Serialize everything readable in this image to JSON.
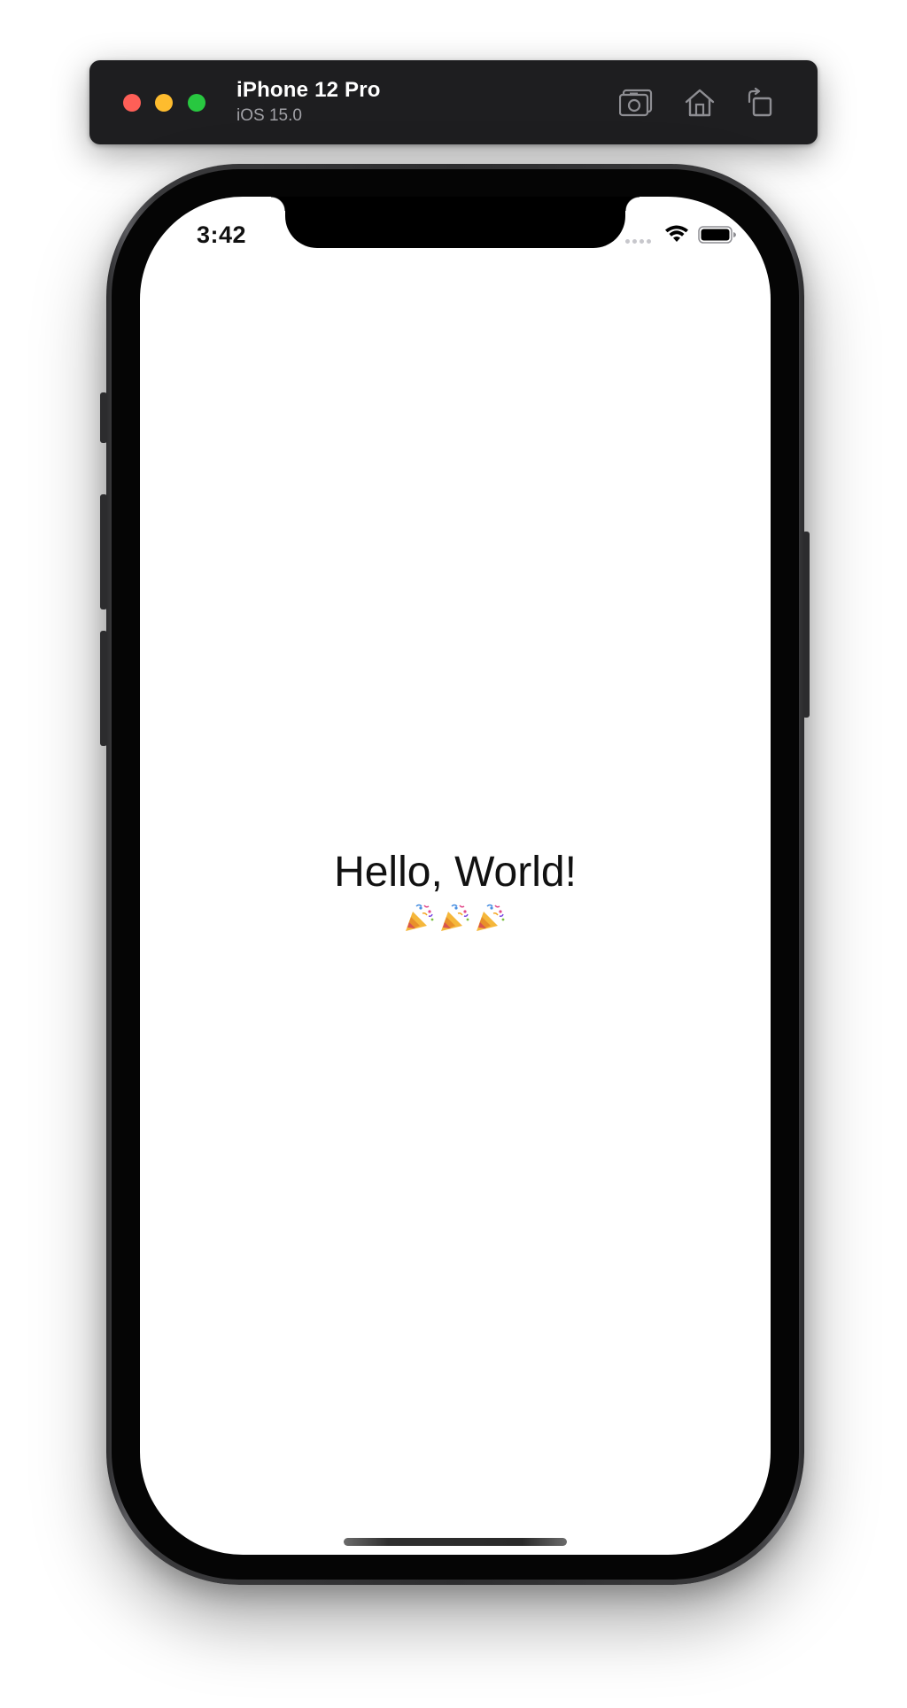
{
  "toolbar": {
    "device_name": "iPhone 12 Pro",
    "os_version": "iOS 15.0",
    "buttons": [
      {
        "name": "screenshot",
        "icon": "camera-icon"
      },
      {
        "name": "home",
        "icon": "home-icon"
      },
      {
        "name": "rotate",
        "icon": "rotate-icon"
      }
    ],
    "traffic_colors": {
      "close": "#fe5f57",
      "minimize": "#febc2e",
      "maximize": "#28c840"
    }
  },
  "status_bar": {
    "time": "3:42",
    "icons": [
      "cellular-signal-icon",
      "wifi-icon",
      "battery-icon"
    ]
  },
  "screen": {
    "greeting": "Hello, World!",
    "emoji_icons": [
      "party-popper-icon",
      "party-popper-icon",
      "party-popper-icon"
    ]
  }
}
